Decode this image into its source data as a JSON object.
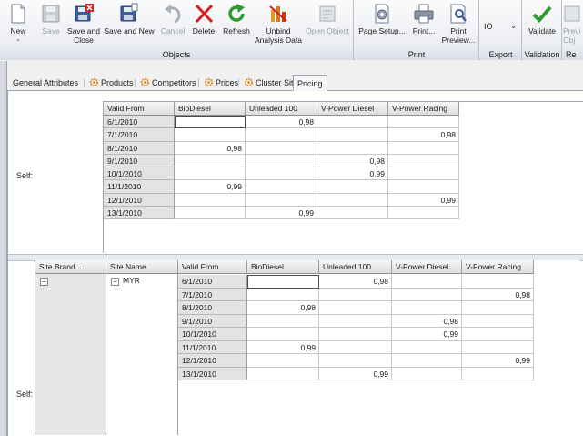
{
  "ribbon": {
    "groups": {
      "objects": "Objects",
      "print": "Print",
      "export": "Export",
      "validation": "Validation",
      "re": "Re"
    },
    "buttons": {
      "new": "New",
      "save": "Save",
      "save_close_1": "Save and",
      "save_close_2": "Close",
      "save_new": "Save and New",
      "cancel": "Cancel",
      "delete": "Delete",
      "refresh": "Refresh",
      "unbind_1": "Unbind",
      "unbind_2": "Analysis Data",
      "open_object": "Open Object",
      "page_setup": "Page Setup...",
      "print": "Print...",
      "print_preview_1": "Print",
      "print_preview_2": "Preview...",
      "io": "IO",
      "validate": "Validate",
      "preview_1": "Previ",
      "preview_2": "Obj"
    }
  },
  "tabs": [
    "General Attributes",
    "Products",
    "Competitors",
    "Prices",
    "Cluster Sites",
    "Pricing"
  ],
  "self_label": "Self:",
  "grid1": {
    "columns": [
      "Valid From",
      "BioDiesel",
      "Unleaded 100",
      "V-Power Diesel",
      "V-Power Racing"
    ],
    "rows": [
      [
        "6/1/2010",
        "",
        "0,98",
        "",
        ""
      ],
      [
        "7/1/2010",
        "",
        "",
        "",
        "0,98"
      ],
      [
        "8/1/2010",
        "0,98",
        "",
        "",
        ""
      ],
      [
        "9/1/2010",
        "",
        "",
        "0,98",
        ""
      ],
      [
        "10/1/2010",
        "",
        "",
        "0,99",
        ""
      ],
      [
        "11/1/2010",
        "0,99",
        "",
        "",
        ""
      ],
      [
        "12/1/2010",
        "",
        "",
        "",
        "0,99"
      ],
      [
        "13/1/2010",
        "",
        "0,99",
        "",
        ""
      ]
    ]
  },
  "grid2": {
    "group_columns": [
      "Site.Brand....",
      "Site.Name"
    ],
    "group_value": "MYR",
    "columns": [
      "Valid From",
      "BioDiesel",
      "Unleaded 100",
      "V-Power Diesel",
      "V-Power Racing"
    ],
    "rows": [
      [
        "6/1/2010",
        "",
        "0,98",
        "",
        ""
      ],
      [
        "7/1/2010",
        "",
        "",
        "",
        "0,98"
      ],
      [
        "8/1/2010",
        "0,98",
        "",
        "",
        ""
      ],
      [
        "9/1/2010",
        "",
        "",
        "0,98",
        ""
      ],
      [
        "10/1/2010",
        "",
        "",
        "0,99",
        ""
      ],
      [
        "11/1/2010",
        "0,99",
        "",
        "",
        ""
      ],
      [
        "12/1/2010",
        "",
        "",
        "",
        "0,99"
      ],
      [
        "13/1/2010",
        "",
        "0,99",
        "",
        ""
      ]
    ]
  },
  "colors": {
    "accent_red": "#d62020",
    "accent_green": "#2f9a2f",
    "ribbon_border": "#a9b2bf"
  }
}
